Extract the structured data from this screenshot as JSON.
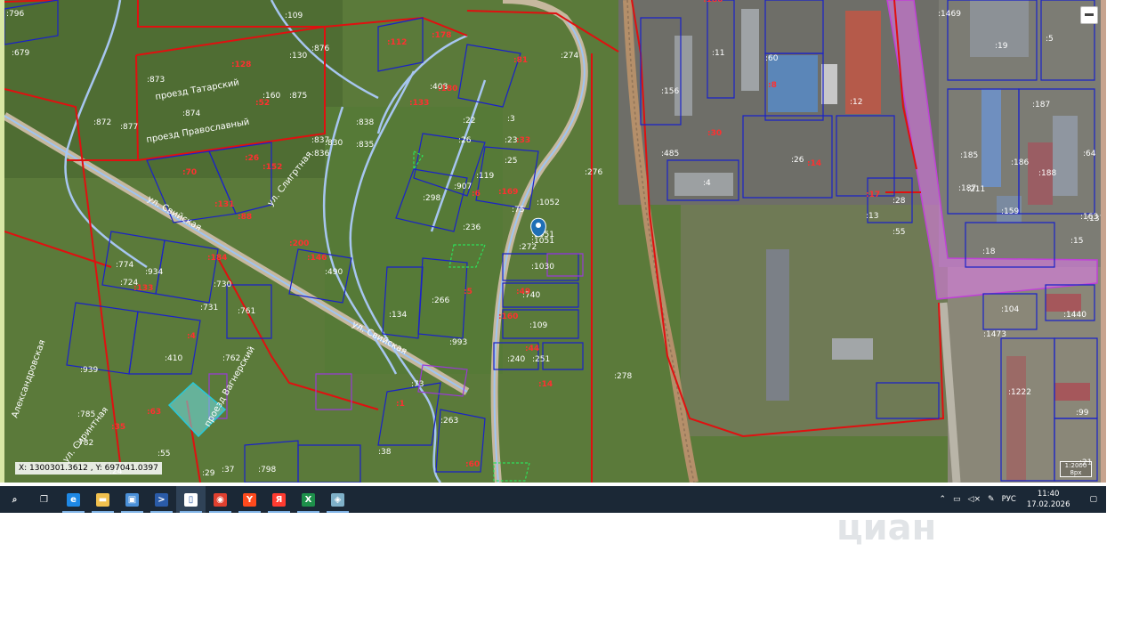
{
  "map": {
    "coordinates": "X: 1300301.3612 , Y: 697041.0397",
    "scale_label": "1:2000",
    "scale_units": "8px",
    "marker_label": ":1051",
    "streets": [
      "проезд Татарский",
      "проезд Православный",
      "ул. Свийская",
      "ул. Свийская",
      "ул. Слигртная",
      "ул. Сиринтная",
      "проезд Вагнерский",
      "Александровская"
    ],
    "parcels": [
      ":796",
      ":679",
      ":872",
      ":873",
      ":874",
      ":877",
      ":109",
      ":130",
      ":160",
      ":875",
      ":876",
      ":838",
      ":835",
      ":830",
      ":836",
      ":837",
      ":408",
      ":274",
      ":22",
      ":3",
      ":26",
      ":23",
      ":25",
      ":119",
      ":907",
      ":298",
      ":236",
      ":75",
      ":1052",
      ":1051",
      ":1030",
      ":740",
      ":109",
      ":251",
      ":240",
      ":276",
      ":278",
      ":266",
      ":134",
      ":993",
      ":263",
      ":38",
      ":55",
      ":798",
      ":730",
      ":731",
      ":762",
      ":761",
      ":490",
      ":934",
      ":774",
      ":724",
      ":939",
      ":410",
      ":785",
      ":782",
      ":29",
      ":37",
      ":24",
      ":73",
      ":272",
      ":156",
      ":11",
      ":60",
      ":12",
      ":13",
      ":28",
      ":55",
      ":159",
      ":5",
      ":4",
      ":26",
      ":185",
      ":186",
      ":187",
      ":188",
      ":163",
      ":15",
      ":137",
      ":18",
      ":19",
      ":1469",
      ":1222",
      ":1440",
      ":1473",
      ":104",
      ":99",
      ":21",
      ":485",
      ":187",
      ":211",
      ":64"
    ],
    "red_labels": [
      ":128",
      ":52",
      ":112",
      ":178",
      ":180",
      ":133",
      ":26",
      ":152",
      ":70",
      ":88",
      ":131",
      ":184",
      ":200",
      ":146",
      ":6",
      ":169",
      ":33",
      ":81",
      ":49",
      ":160",
      ":44",
      ":14",
      ":1",
      ":60",
      ":5",
      ":133",
      ":4",
      ":63",
      ":35",
      ":180",
      ":30",
      ":8",
      ":14",
      ":17"
    ]
  },
  "taskbar": {
    "icons": [
      {
        "name": "search-icon",
        "glyph": "⌕"
      },
      {
        "name": "task-view-icon",
        "glyph": "❐"
      },
      {
        "name": "internet-explorer-icon",
        "glyph": "e"
      },
      {
        "name": "file-explorer-icon",
        "glyph": "▬"
      },
      {
        "name": "remote-desktop-icon",
        "glyph": "▣"
      },
      {
        "name": "powershell-icon",
        "glyph": ">"
      },
      {
        "name": "notepad-icon",
        "glyph": "▯"
      },
      {
        "name": "chrome-icon",
        "glyph": "◉"
      },
      {
        "name": "yandex-browser-icon",
        "glyph": "Y"
      },
      {
        "name": "yandex-icon",
        "glyph": "Я"
      },
      {
        "name": "excel-icon",
        "glyph": "X"
      },
      {
        "name": "map-app-icon",
        "glyph": "◈"
      }
    ],
    "language": "РУС",
    "time": "11:40",
    "date": "17.02.2026"
  },
  "watermark": "циан",
  "colors": {
    "boundary_red": "#e01010",
    "boundary_blue": "#1a22c8",
    "boundary_purple": "#9a3ad6",
    "road_lightblue": "#9ec4f2",
    "zone_magenta": "#e37af0",
    "taskbar_bg": "#1b2836"
  }
}
